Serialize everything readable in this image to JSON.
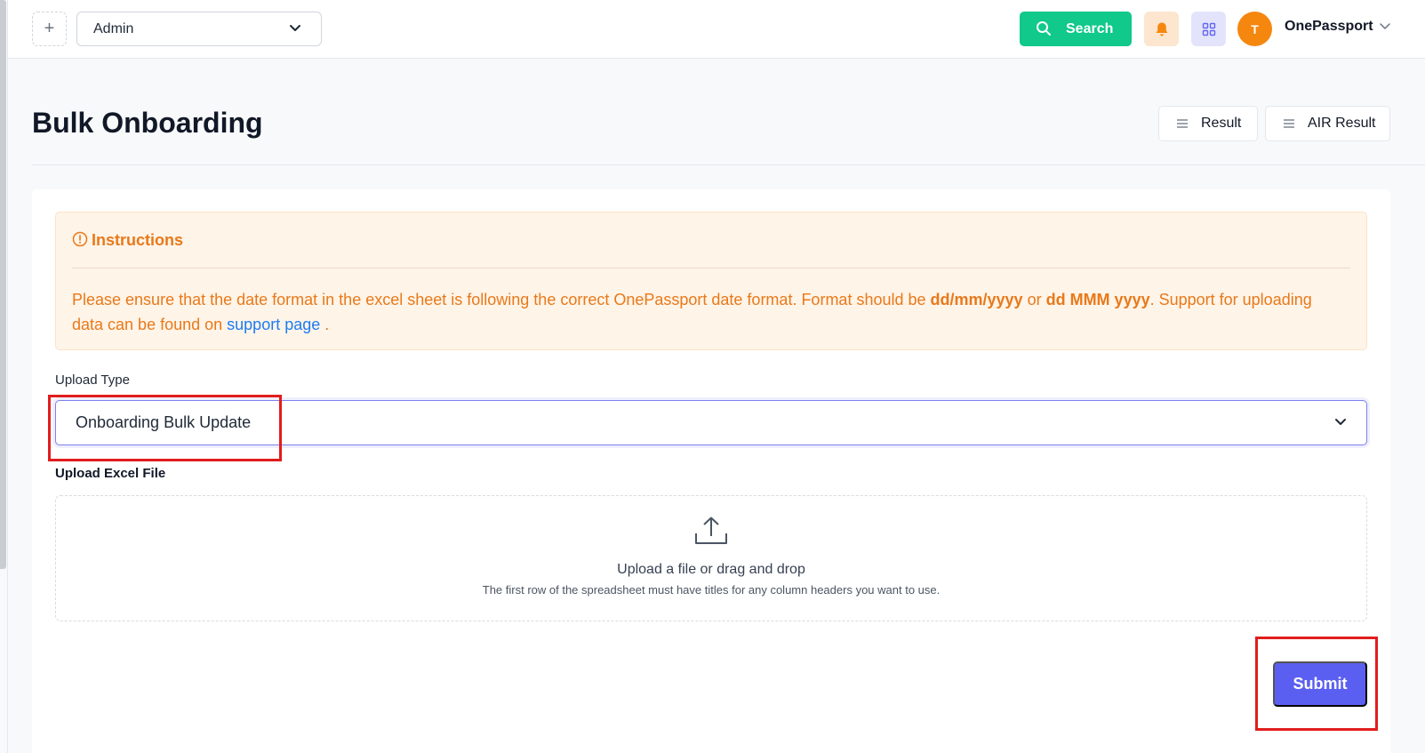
{
  "topbar": {
    "plus_symbol": "+",
    "role_selected": "Admin",
    "search_label": "Search",
    "avatar_initial": "T",
    "org_name": "OnePassport"
  },
  "page": {
    "title": "Bulk Onboarding",
    "result_label": "Result",
    "air_result_label": "AIR Result"
  },
  "instructions": {
    "title": "Instructions",
    "text_1": "Please ensure that the date format in the excel sheet is following the correct OnePassport date format. Format should be ",
    "format_1": "dd/mm/yyyy",
    "text_or": " or ",
    "format_2": "dd MMM yyyy",
    "text_2": ". Support for uploading data can be found on ",
    "link_text": "support page",
    "text_end": " ."
  },
  "form": {
    "upload_type_label": "Upload Type",
    "upload_type_value": "Onboarding Bulk Update",
    "upload_file_label": "Upload Excel File",
    "dropzone_main": "Upload a file or drag and drop",
    "dropzone_sub": "The first row of the spreadsheet must have titles for any column headers you want to use.",
    "submit_label": "Submit"
  },
  "colors": {
    "accent": "#5b5ff1",
    "search_green": "#10c98a",
    "warning_orange": "#e8791a",
    "highlight_red": "#e11d1d"
  }
}
